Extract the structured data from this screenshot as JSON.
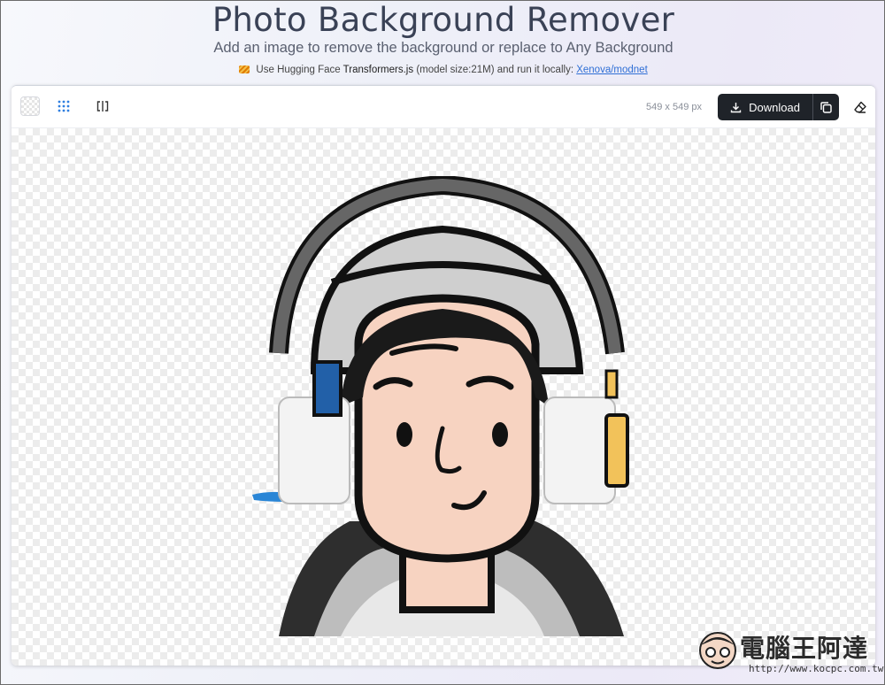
{
  "header": {
    "title": "Photo Background Remover",
    "subtitle": "Add an image to remove the background or replace to Any Background",
    "credit_prefix": "Use Hugging Face",
    "credit_lib": "Transformers.js",
    "credit_mid": "(model size:21M) and run it locally:",
    "credit_link": "Xenova/modnet"
  },
  "toolbar": {
    "dimensions": "549 x 549 px",
    "download_label": "Download",
    "icons": [
      "transparent-bg-icon",
      "grid-icon",
      "compare-icon",
      "download-icon",
      "copy-icon",
      "eraser-icon"
    ]
  },
  "watermark": {
    "brand": "電腦王阿達",
    "url": "http://www.kocpc.com.tw"
  },
  "colors": {
    "download_bg": "#1f2329",
    "grid_icon": "#2f7fe0",
    "link": "#2f6fd6"
  }
}
